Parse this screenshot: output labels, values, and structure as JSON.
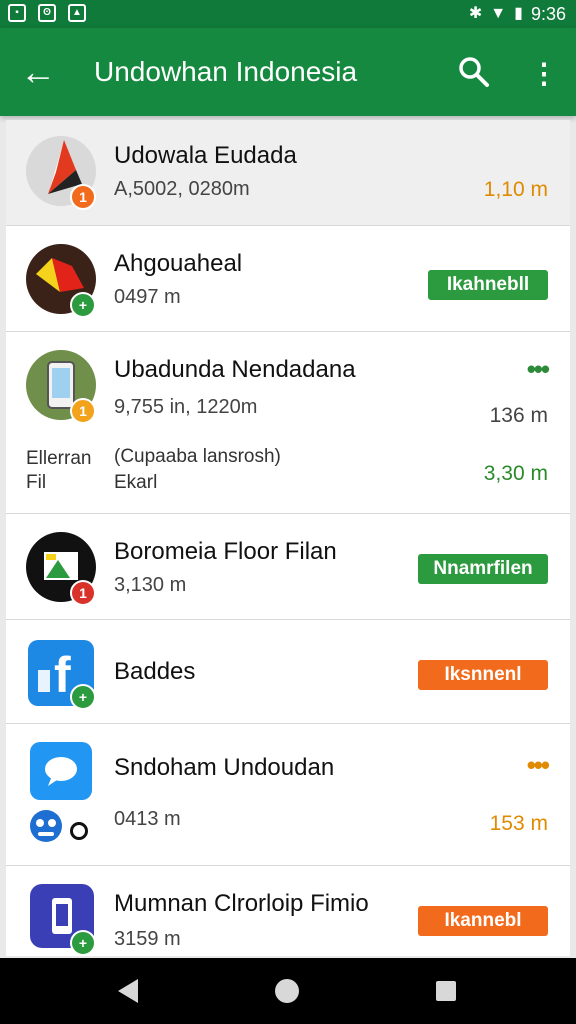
{
  "status_bar": {
    "left_icons": [
      "sim-icon",
      "nfc-icon",
      "image-icon"
    ],
    "time": "9:36"
  },
  "app_bar": {
    "back_icon": "arrow-left-icon",
    "title": "Undowhan Indonesia",
    "search_icon": "search-icon",
    "menu_icon": "more-vert-icon"
  },
  "colors": {
    "primary": "#15893f",
    "status_bar": "#0f7a3a",
    "button_green": "#2c9a3e",
    "button_orange": "#f26a1b",
    "value_orange": "#e08a00",
    "value_green": "#2a8a2a"
  },
  "list": {
    "items": [
      {
        "name": "Udowala Eudada",
        "subtitle": "A,5002, 0280m",
        "right_value": "1,10 m",
        "badge_icon": "number-badge-icon",
        "badge_text": "1"
      },
      {
        "name": "Ahgouaheal",
        "subtitle": "0497 m",
        "button_label": "Ikahnebll",
        "badge_icon": "plus-badge-icon",
        "badge_text": "+"
      },
      {
        "name": "Ubadunda Nendadana",
        "subtitle": "9,755 in, 1220m",
        "right_value": "136 m",
        "menu_icon": "more-horiz-icon",
        "extra_label_1": "Ellerran",
        "extra_label_2": "Fil",
        "extra_detail_1": "(Cupaaba lansrosh)",
        "extra_detail_2": "Ekarl",
        "extra_value": "3,30 m",
        "badge_icon": "number-badge-icon",
        "badge_text": "1"
      },
      {
        "name": "Boromeia Floor Filan",
        "subtitle": "3,130 m",
        "button_label": "Nnamrfilen",
        "badge_icon": "number-badge-icon",
        "badge_text": "1"
      },
      {
        "name": "Baddes",
        "button_label": "Iksnnenl",
        "badge_icon": "plus-badge-icon",
        "badge_text": "+"
      },
      {
        "name": "Sndoham Undoudan",
        "subtitle": "0413 m",
        "right_value": "153 m",
        "menu_icon": "more-horiz-icon"
      },
      {
        "name": "Mumnan Clrorloip Fimio",
        "subtitle": "3159 m",
        "button_label": "Ikannebl",
        "badge_icon": "plus-badge-icon",
        "badge_text": "+"
      }
    ]
  },
  "nav_bar": {
    "back_icon": "nav-back-icon",
    "home_icon": "nav-home-icon",
    "recents_icon": "nav-recents-icon"
  }
}
